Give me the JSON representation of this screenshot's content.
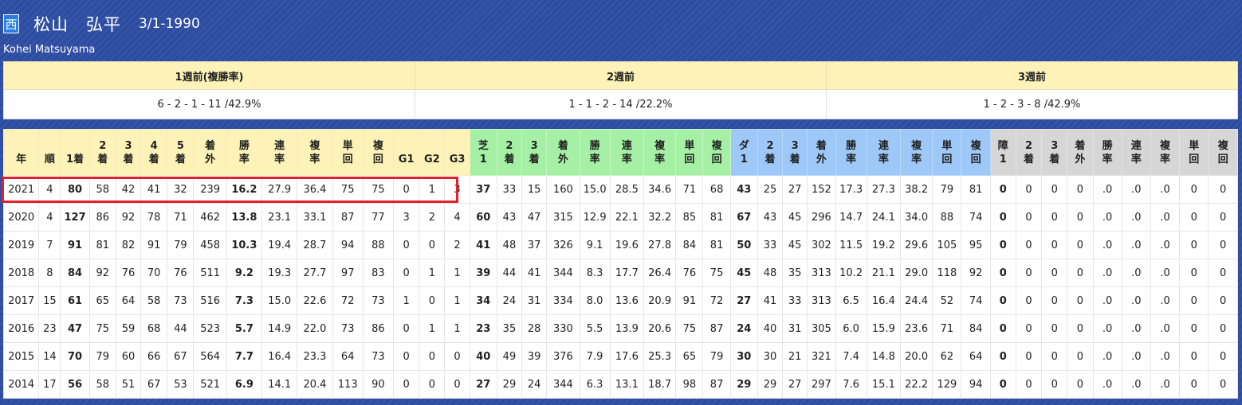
{
  "profile": {
    "region_badge": "西",
    "name_ja": "松山　弘平",
    "birthdate": "3/1-1990",
    "name_en": "Kohei Matsuyama"
  },
  "recent_weeks": [
    {
      "label": "1週前(複勝率)",
      "value": "6 - 2 - 1 - 11 /42.9%"
    },
    {
      "label": "2週前",
      "value": "1 - 1 - 2 - 14 /22.2%"
    },
    {
      "label": "3週前",
      "value": "1 - 2 - 3 - 8 /42.9%"
    }
  ],
  "stats_table": {
    "columns": [
      {
        "l1": "",
        "l2": "年",
        "grp": "y"
      },
      {
        "l1": "",
        "l2": "順",
        "grp": "y"
      },
      {
        "l1": "",
        "l2": "1着",
        "grp": "y"
      },
      {
        "l1": "2",
        "l2": "着",
        "grp": "y"
      },
      {
        "l1": "3",
        "l2": "着",
        "grp": "y"
      },
      {
        "l1": "4",
        "l2": "着",
        "grp": "y"
      },
      {
        "l1": "5",
        "l2": "着",
        "grp": "y"
      },
      {
        "l1": "着",
        "l2": "外",
        "grp": "y"
      },
      {
        "l1": "勝",
        "l2": "率",
        "grp": "y"
      },
      {
        "l1": "連",
        "l2": "率",
        "grp": "y"
      },
      {
        "l1": "複",
        "l2": "率",
        "grp": "y"
      },
      {
        "l1": "単",
        "l2": "回",
        "grp": "y"
      },
      {
        "l1": "複",
        "l2": "回",
        "grp": "y"
      },
      {
        "l1": "",
        "l2": "G1",
        "grp": "y"
      },
      {
        "l1": "",
        "l2": "G2",
        "grp": "y"
      },
      {
        "l1": "",
        "l2": "G3",
        "grp": "y"
      },
      {
        "l1": "芝",
        "l2": "1",
        "grp": "g"
      },
      {
        "l1": "2",
        "l2": "着",
        "grp": "g"
      },
      {
        "l1": "3",
        "l2": "着",
        "grp": "g"
      },
      {
        "l1": "着",
        "l2": "外",
        "grp": "g"
      },
      {
        "l1": "勝",
        "l2": "率",
        "grp": "g"
      },
      {
        "l1": "連",
        "l2": "率",
        "grp": "g"
      },
      {
        "l1": "複",
        "l2": "率",
        "grp": "g"
      },
      {
        "l1": "単",
        "l2": "回",
        "grp": "g"
      },
      {
        "l1": "複",
        "l2": "回",
        "grp": "g"
      },
      {
        "l1": "ダ",
        "l2": "1",
        "grp": "b"
      },
      {
        "l1": "2",
        "l2": "着",
        "grp": "b"
      },
      {
        "l1": "3",
        "l2": "着",
        "grp": "b"
      },
      {
        "l1": "着",
        "l2": "外",
        "grp": "b"
      },
      {
        "l1": "勝",
        "l2": "率",
        "grp": "b"
      },
      {
        "l1": "連",
        "l2": "率",
        "grp": "b"
      },
      {
        "l1": "複",
        "l2": "率",
        "grp": "b"
      },
      {
        "l1": "単",
        "l2": "回",
        "grp": "b"
      },
      {
        "l1": "複",
        "l2": "回",
        "grp": "b"
      },
      {
        "l1": "障",
        "l2": "1",
        "grp": "s"
      },
      {
        "l1": "2",
        "l2": "着",
        "grp": "s"
      },
      {
        "l1": "3",
        "l2": "着",
        "grp": "s"
      },
      {
        "l1": "着",
        "l2": "外",
        "grp": "s"
      },
      {
        "l1": "勝",
        "l2": "率",
        "grp": "s"
      },
      {
        "l1": "連",
        "l2": "率",
        "grp": "s"
      },
      {
        "l1": "複",
        "l2": "率",
        "grp": "s"
      },
      {
        "l1": "単",
        "l2": "回",
        "grp": "s"
      },
      {
        "l1": "複",
        "l2": "回",
        "grp": "s"
      }
    ],
    "bold_columns": [
      2,
      8,
      16,
      25,
      34
    ],
    "highlighted_row": 0,
    "rows": [
      [
        "2021",
        "4",
        "80",
        "58",
        "42",
        "41",
        "32",
        "239",
        "16.2",
        "27.9",
        "36.4",
        "75",
        "75",
        "0",
        "1",
        "3",
        "37",
        "33",
        "15",
        "160",
        "15.0",
        "28.5",
        "34.6",
        "71",
        "68",
        "43",
        "25",
        "27",
        "152",
        "17.3",
        "27.3",
        "38.2",
        "79",
        "81",
        "0",
        "0",
        "0",
        "0",
        ".0",
        ".0",
        ".0",
        "0",
        "0"
      ],
      [
        "2020",
        "4",
        "127",
        "86",
        "92",
        "78",
        "71",
        "462",
        "13.8",
        "23.1",
        "33.1",
        "87",
        "77",
        "3",
        "2",
        "4",
        "60",
        "43",
        "47",
        "315",
        "12.9",
        "22.1",
        "32.2",
        "85",
        "81",
        "67",
        "43",
        "45",
        "296",
        "14.7",
        "24.1",
        "34.0",
        "88",
        "74",
        "0",
        "0",
        "0",
        "0",
        ".0",
        ".0",
        ".0",
        "0",
        "0"
      ],
      [
        "2019",
        "7",
        "91",
        "81",
        "82",
        "91",
        "79",
        "458",
        "10.3",
        "19.4",
        "28.7",
        "94",
        "88",
        "0",
        "0",
        "2",
        "41",
        "48",
        "37",
        "326",
        "9.1",
        "19.6",
        "27.8",
        "84",
        "81",
        "50",
        "33",
        "45",
        "302",
        "11.5",
        "19.2",
        "29.6",
        "105",
        "95",
        "0",
        "0",
        "0",
        "0",
        ".0",
        ".0",
        ".0",
        "0",
        "0"
      ],
      [
        "2018",
        "8",
        "84",
        "92",
        "76",
        "70",
        "76",
        "511",
        "9.2",
        "19.3",
        "27.7",
        "97",
        "83",
        "0",
        "1",
        "1",
        "39",
        "44",
        "41",
        "344",
        "8.3",
        "17.7",
        "26.4",
        "76",
        "75",
        "45",
        "48",
        "35",
        "313",
        "10.2",
        "21.1",
        "29.0",
        "118",
        "92",
        "0",
        "0",
        "0",
        "0",
        ".0",
        ".0",
        ".0",
        "0",
        "0"
      ],
      [
        "2017",
        "15",
        "61",
        "65",
        "64",
        "58",
        "73",
        "516",
        "7.3",
        "15.0",
        "22.6",
        "72",
        "73",
        "1",
        "0",
        "1",
        "34",
        "24",
        "31",
        "334",
        "8.0",
        "13.6",
        "20.9",
        "91",
        "72",
        "27",
        "41",
        "33",
        "313",
        "6.5",
        "16.4",
        "24.4",
        "52",
        "74",
        "0",
        "0",
        "0",
        "0",
        ".0",
        ".0",
        ".0",
        "0",
        "0"
      ],
      [
        "2016",
        "23",
        "47",
        "75",
        "59",
        "68",
        "44",
        "523",
        "5.7",
        "14.9",
        "22.0",
        "73",
        "86",
        "0",
        "1",
        "1",
        "23",
        "35",
        "28",
        "330",
        "5.5",
        "13.9",
        "20.6",
        "75",
        "87",
        "24",
        "40",
        "31",
        "305",
        "6.0",
        "15.9",
        "23.6",
        "71",
        "84",
        "0",
        "0",
        "0",
        "0",
        ".0",
        ".0",
        ".0",
        "0",
        "0"
      ],
      [
        "2015",
        "14",
        "70",
        "79",
        "60",
        "66",
        "67",
        "564",
        "7.7",
        "16.4",
        "23.3",
        "64",
        "73",
        "0",
        "0",
        "0",
        "40",
        "49",
        "39",
        "376",
        "7.9",
        "17.6",
        "25.3",
        "65",
        "79",
        "30",
        "30",
        "21",
        "321",
        "7.4",
        "14.8",
        "20.0",
        "62",
        "64",
        "0",
        "0",
        "0",
        "0",
        ".0",
        ".0",
        ".0",
        "0",
        "0"
      ],
      [
        "2014",
        "17",
        "56",
        "58",
        "51",
        "67",
        "53",
        "521",
        "6.9",
        "14.1",
        "20.4",
        "113",
        "90",
        "0",
        "0",
        "0",
        "27",
        "29",
        "24",
        "344",
        "6.3",
        "13.1",
        "18.7",
        "98",
        "87",
        "29",
        "29",
        "27",
        "297",
        "7.6",
        "15.1",
        "22.2",
        "129",
        "94",
        "0",
        "0",
        "0",
        "0",
        ".0",
        ".0",
        ".0",
        "0",
        "0"
      ]
    ]
  }
}
